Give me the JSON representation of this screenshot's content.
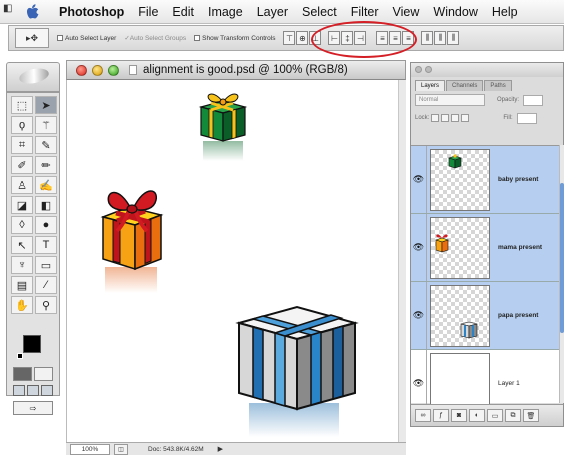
{
  "menubar": {
    "app_name": "Photoshop",
    "items": [
      "File",
      "Edit",
      "Image",
      "Layer",
      "Select",
      "Filter",
      "View",
      "Window",
      "Help"
    ]
  },
  "options_bar": {
    "auto_select_layer": "Auto Select Layer",
    "auto_select_groups": "Auto Select Groups",
    "show_transform_controls": "Show Transform Controls",
    "align_buttons": [
      "top-edges",
      "vertical-centers",
      "bottom-edges",
      "left-edges",
      "horizontal-centers",
      "right-edges"
    ],
    "distribute_buttons": [
      "distribute-top",
      "distribute-vcenter",
      "distribute-bottom",
      "distribute-left",
      "distribute-hcenter",
      "distribute-right"
    ],
    "highlight_color": "#d41f26"
  },
  "document": {
    "title": "alignment is good.psd @ 100% (RGB/8)",
    "zoom": "100%",
    "doc_info": "Doc: 543.8K/4.62M"
  },
  "layers_palette": {
    "tabs": [
      "Layers",
      "Channels",
      "Paths"
    ],
    "blend_mode": "Normal",
    "opacity_label": "Opacity:",
    "lock_label": "Lock:",
    "fill_label": "Fill:",
    "layers": [
      {
        "name": "baby present",
        "selected": true,
        "visible": true
      },
      {
        "name": "mama present",
        "selected": true,
        "visible": true
      },
      {
        "name": "papa present",
        "selected": true,
        "visible": true
      },
      {
        "name": "Layer 1",
        "selected": false,
        "visible": true
      }
    ]
  }
}
